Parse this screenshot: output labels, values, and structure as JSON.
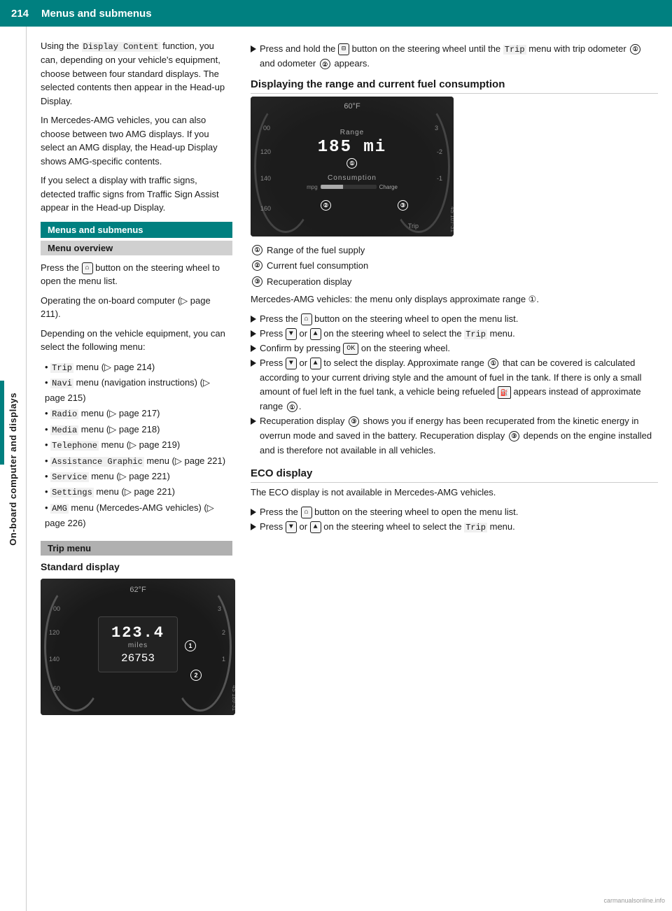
{
  "header": {
    "page_number": "214",
    "title": "Menus and submenus"
  },
  "left_tab_label": "On-board computer and displays",
  "left_column": {
    "intro": {
      "p1": "Using the Display Content function, you can, depending on your vehicle's equipment, choose between four standard displays. The selected contents then appear in the Head-up Display.",
      "p2": "In Mercedes-AMG vehicles, you can also choose between two AMG displays. If you select an AMG display, the Head-up Display shows AMG-specific contents.",
      "p3": "If you select a display with traffic signs, detected traffic signs from Traffic Sign Assist appear in the Head-up Display."
    },
    "menus_submenus_header": "Menus and submenus",
    "menu_overview_header": "Menu overview",
    "menu_overview_text1": "Press the",
    "menu_overview_btn": "⌂",
    "menu_overview_text2": "button on the steering wheel to open the menu list.",
    "operating_text": "Operating the on-board computer (▷ page 211).",
    "depending_text": "Depending on the vehicle equipment, you can select the following menu:",
    "menu_items": [
      {
        "label": "Trip",
        "suffix": " menu (▷ page 214)"
      },
      {
        "label": "Navi",
        "suffix": " menu (navigation instructions) (▷ page 215)"
      },
      {
        "label": "Radio",
        "suffix": " menu (▷ page 217)"
      },
      {
        "label": "Media",
        "suffix": " menu (▷ page 218)"
      },
      {
        "label": "Telephone",
        "suffix": " menu (▷ page 219)"
      },
      {
        "label": "Assistance Graphic",
        "suffix": " menu (▷ page 221)"
      },
      {
        "label": "Service",
        "suffix": " menu (▷ page 221)"
      },
      {
        "label": "Settings",
        "suffix": " menu (▷ page 221)"
      },
      {
        "label": "AMG",
        "suffix": " menu (Mercedes-AMG vehicles) (▷ page 226)"
      }
    ],
    "trip_menu_header": "Trip menu",
    "std_display_header": "Standard display",
    "dashboard_temp": "62°F",
    "dashboard_miles": "123.4",
    "dashboard_miles_label": "miles",
    "dashboard_odo": "26753",
    "dashboard_circle1": "①",
    "dashboard_circle2": "②"
  },
  "right_column": {
    "press_hold_text": "Press and hold the",
    "press_hold_btn": "⊟",
    "press_hold_text2": "button on the steering wheel until the",
    "press_hold_code": "Trip",
    "press_hold_text3": "menu with trip odometer",
    "press_hold_circle1": "①",
    "press_hold_text4": "and odometer",
    "press_hold_circle2": "②",
    "press_hold_text5": "appears.",
    "fuel_section_title": "Displaying the range and current fuel consumption",
    "right_dash_temp": "60°F",
    "right_dash_range_label": "Range",
    "right_dash_range_miles": "185 mi",
    "right_dash_consumption_label": "Consumption",
    "right_dash_charge_label": "Charge",
    "right_dash_trip_label": "Trip",
    "right_dash_circle1": "①",
    "right_dash_circle2": "②",
    "right_dash_circle3": "③",
    "notes": [
      {
        "circle": "①",
        "text": "Range of the fuel supply"
      },
      {
        "circle": "②",
        "text": "Current fuel consumption"
      },
      {
        "circle": "③",
        "text": "Recuperation display"
      }
    ],
    "amg_note": "Mercedes-AMG vehicles: the menu only displays approximate range ①.",
    "instructions": [
      "Press the ⌂ button on the steering wheel to open the menu list.",
      "Press ▼ or ▲ on the steering wheel to select the Trip menu.",
      "Confirm by pressing OK on the steering wheel.",
      "Press ▼ or ▲ to select the display. Approximate range ① that can be covered is calculated according to your current driving style and the amount of fuel in the tank. If there is only a small amount of fuel left in the fuel tank, a vehicle being refueled 🔋 appears instead of approximate range ①.",
      "Recuperation display ③ shows you if energy has been recuperated from the kinetic energy in overrun mode and saved in the battery. Recuperation display ③ depends on the engine installed and is therefore not available in all vehicles."
    ],
    "eco_section_title": "ECO display",
    "eco_p1": "The ECO display is not available in Mercedes-AMG vehicles.",
    "eco_instructions": [
      "Press the ⌂ button on the steering wheel to open the menu list.",
      "Press ▼ or ▲ on the steering wheel to select the Trip menu."
    ],
    "watermark": "4S 189-31"
  }
}
